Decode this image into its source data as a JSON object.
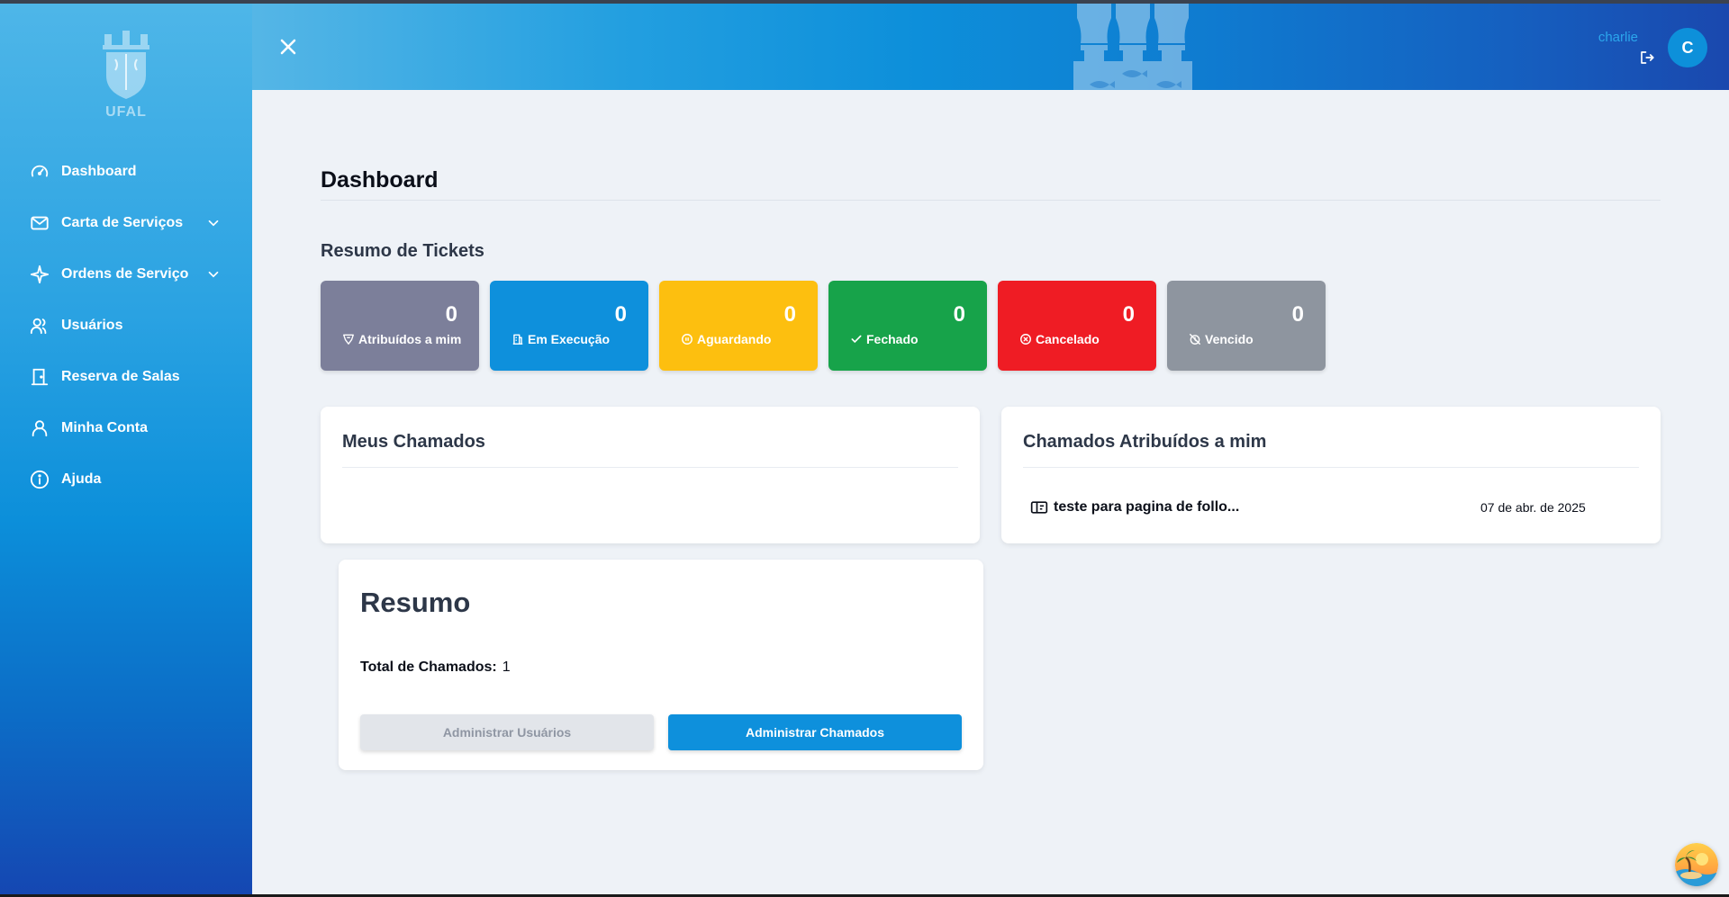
{
  "sidebar": {
    "logo_text": "UFAL",
    "items": [
      {
        "label": "Dashboard",
        "icon": "gauge-icon"
      },
      {
        "label": "Carta de Serviços",
        "icon": "mail-icon",
        "has_submenu": true
      },
      {
        "label": "Ordens de Serviço",
        "icon": "sparkle-icon",
        "has_submenu": true
      },
      {
        "label": "Usuários",
        "icon": "users-icon"
      },
      {
        "label": "Reserva de Salas",
        "icon": "door-icon"
      },
      {
        "label": "Minha Conta",
        "icon": "user-icon"
      },
      {
        "label": "Ajuda",
        "icon": "info-icon"
      }
    ]
  },
  "header": {
    "username": "charlie",
    "avatar_initial": "C"
  },
  "main": {
    "title": "Dashboard",
    "summary_title": "Resumo de Tickets",
    "stats": [
      {
        "label": "Atribuídos a mim",
        "value": "0",
        "color": "#7c7f9a",
        "icon": "badge-icon"
      },
      {
        "label": "Em Execução",
        "value": "0",
        "color": "#0e90dc",
        "icon": "building-icon"
      },
      {
        "label": "Aguardando",
        "value": "0",
        "color": "#fdbf0f",
        "icon": "pause-circle-icon"
      },
      {
        "label": "Fechado",
        "value": "0",
        "color": "#17a34a",
        "icon": "check-icon"
      },
      {
        "label": "Cancelado",
        "value": "0",
        "color": "#ef1c24",
        "icon": "x-circle-icon"
      },
      {
        "label": "Vencido",
        "value": "0",
        "color": "#8e959f",
        "icon": "alarm-off-icon"
      }
    ],
    "my_calls": {
      "title": "Meus Chamados"
    },
    "assigned_calls": {
      "title": "Chamados Atribuídos a mim",
      "items": [
        {
          "subject": "teste para pagina de follo...",
          "date": "07 de abr. de 2025"
        }
      ]
    },
    "resumo": {
      "title": "Resumo",
      "total_label": "Total de Chamados:",
      "total_value": "1",
      "btn_users": "Administrar Usuários",
      "btn_calls": "Administrar Chamados"
    }
  }
}
